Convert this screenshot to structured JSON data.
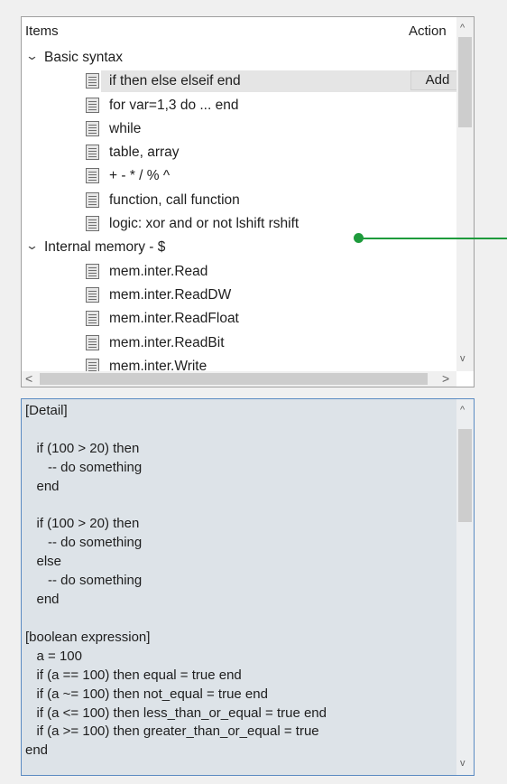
{
  "header": {
    "items_label": "Items",
    "action_label": "Action"
  },
  "groups": [
    {
      "label": "Basic syntax",
      "items": [
        "if then else elseif end",
        "for var=1,3 do ... end",
        "while",
        "table, array",
        "+ - * / % ^",
        "function, call function",
        "logic: xor and or not lshift rshift"
      ]
    },
    {
      "label": "Internal memory - $",
      "items": [
        "mem.inter.Read",
        "mem.inter.ReadDW",
        "mem.inter.ReadFloat",
        "mem.inter.ReadBit",
        "mem.inter.Write"
      ]
    }
  ],
  "add_button_label": "Add",
  "scroll": {
    "up": "^",
    "down": "v",
    "left": "<",
    "right": ">"
  },
  "detail": {
    "text": "[Detail]\n\n   if (100 > 20) then\n      -- do something\n   end\n\n   if (100 > 20) then\n      -- do something\n   else\n      -- do something\n   end\n\n[boolean expression]\n   a = 100\n   if (a == 100) then equal = true end\n   if (a ~= 100) then not_equal = true end\n   if (a <= 100) then less_than_or_equal = true end\n   if (a >= 100) then greater_than_or_equal = true\nend"
  },
  "colors": {
    "callout": "#1e9b3c",
    "selection": "#e5e5e5",
    "detail_bg": "#dde3e8",
    "detail_border": "#5b8bc2"
  }
}
